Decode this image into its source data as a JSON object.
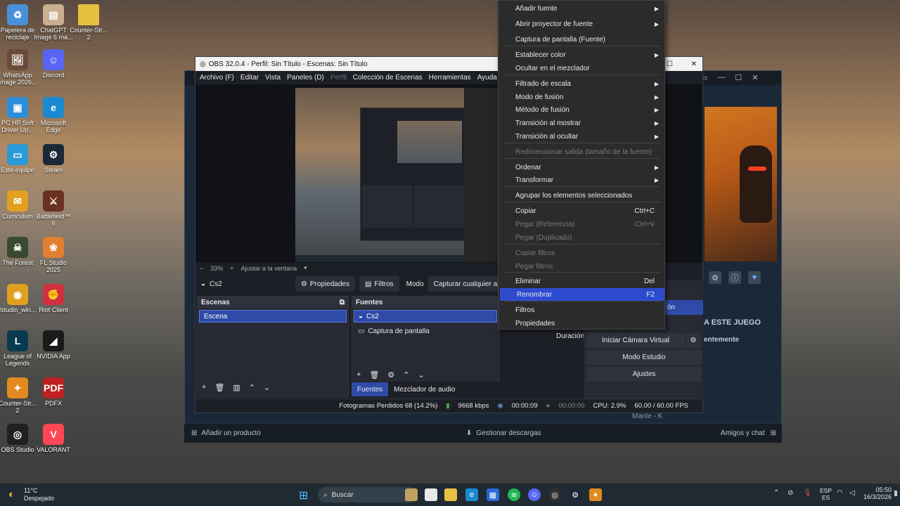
{
  "desktop": {
    "icons": [
      {
        "label": "Papelera de reciclaje",
        "glyph": "♻",
        "color": "#4a90d9"
      },
      {
        "label": "WhatsApp Image 2026...",
        "glyph": "🖼",
        "color": "#6a4a3a"
      },
      {
        "label": "PC HP Soft Driver Up...",
        "glyph": "▣",
        "color": "#2b8ed8"
      },
      {
        "label": "Este equipo",
        "glyph": "▭",
        "color": "#2a9ad8"
      },
      {
        "label": "Curriculum",
        "glyph": "✉",
        "color": "#e0a020"
      },
      {
        "label": "The Forest",
        "glyph": "☠",
        "color": "#3a4a30"
      },
      {
        "label": "fstudio_win...",
        "glyph": "◉",
        "color": "#e0a020"
      },
      {
        "label": "League of Legends",
        "glyph": "L",
        "color": "#0a3a50"
      },
      {
        "label": "Counter-Str... 2",
        "glyph": "✦",
        "color": "#e08a20"
      },
      {
        "label": "OBS Studio",
        "glyph": "◎",
        "color": "#202020"
      }
    ],
    "icons_col2": [
      {
        "label": "ChatGPT Image 6 ma...",
        "glyph": "▤",
        "color": "#c8b090"
      },
      {
        "label": "Discord",
        "glyph": "☺",
        "color": "#5865f2"
      },
      {
        "label": "Microsoft Edge",
        "glyph": "e",
        "color": "#1a8ad0"
      },
      {
        "label": "Steam",
        "glyph": "⚙",
        "color": "#1b2838"
      },
      {
        "label": "Battlefield™ 6",
        "glyph": "⚔",
        "color": "#6a3020"
      },
      {
        "label": "FL Studio 2025",
        "glyph": "❀",
        "color": "#e08030"
      },
      {
        "label": "Riot Client",
        "glyph": "✊",
        "color": "#d03040"
      },
      {
        "label": "NVIDIA App",
        "glyph": "◢",
        "color": "#1a1a1a"
      },
      {
        "label": "PDFX",
        "glyph": "PDF",
        "color": "#c02020"
      },
      {
        "label": "VALORANT",
        "glyph": "V",
        "color": "#ff4655"
      }
    ],
    "folder_label": "Counter-Str... 2"
  },
  "obs": {
    "title": "OBS 32.0.4 - Perfil: Sin Título - Escenas: Sin Título",
    "menu": [
      "Archivo (F)",
      "Editar",
      "Vista",
      "Paneles (D)",
      "Perfil",
      "Colección de Escenas",
      "Herramientas",
      "Ayuda (H)"
    ],
    "zoom": "33%",
    "fit_label": "Ajustar a la ventana",
    "source_name": "Cs2",
    "properties_btn": "Propiedades",
    "filters_btn": "Filtros",
    "mode_label": "Modo",
    "mode_value": "Capturar cualquier aplicaci",
    "scenes_title": "Escenas",
    "scene_items": [
      "Escena"
    ],
    "sources_title": "Fuentes",
    "source_items": [
      "Cs2",
      "Captura de pantalla"
    ],
    "tab_sources": "Fuentes",
    "tab_mixer": "Mezclador de audio",
    "controls": {
      "duration_label": "Duración",
      "virtual_cam": "Iniciar Cámara Virtual",
      "studio_mode": "Modo Estudio",
      "settings": "Ajustes",
      "partial_btn": "ón"
    },
    "status": {
      "dropped": "Fotogramas Perdidos 68 (14.2%)",
      "kbps": "9668 kbps",
      "rec_time": "00:00:09",
      "stream_time": "00:00:00",
      "cpu": "CPU: 2.9%",
      "fps": "60.00 / 60.00 FPS"
    }
  },
  "context_menu": {
    "items": [
      {
        "label": "Añadir fuente",
        "submenu": true,
        "enabled": true
      },
      {
        "label": "Abrir proyector de fuente",
        "submenu": true,
        "enabled": true
      },
      {
        "label": "Captura de pantalla (Fuente)",
        "enabled": true
      },
      {
        "label": "Establecer color",
        "submenu": true,
        "enabled": true
      },
      {
        "label": "Ocultar en el mezclador",
        "enabled": true
      },
      {
        "label": "Filtrado de escala",
        "submenu": true,
        "enabled": true
      },
      {
        "label": "Modo de fusión",
        "submenu": true,
        "enabled": true
      },
      {
        "label": "Método de fusión",
        "submenu": true,
        "enabled": true
      },
      {
        "label": "Transición al mostrar",
        "submenu": true,
        "enabled": true
      },
      {
        "label": "Transición al ocultar",
        "submenu": true,
        "enabled": true
      },
      {
        "label": "Redimensionar salida (tamaño de la fuente)",
        "enabled": false
      },
      {
        "label": "Ordenar",
        "submenu": true,
        "enabled": true
      },
      {
        "label": "Transformar",
        "submenu": true,
        "enabled": true
      },
      {
        "label": "Agrupar los elementos seleccionados",
        "enabled": true
      },
      {
        "label": "Copiar",
        "shortcut": "Ctrl+C",
        "enabled": true
      },
      {
        "label": "Pegar (Referencia)",
        "shortcut": "Ctrl+V",
        "enabled": false
      },
      {
        "label": "Pegar (Duplicado)",
        "enabled": false
      },
      {
        "label": "Copiar filtros",
        "enabled": false
      },
      {
        "label": "Pegar filtros",
        "enabled": false
      },
      {
        "label": "Eliminar",
        "shortcut": "Del",
        "enabled": true
      },
      {
        "label": "Renombrar",
        "shortcut": "F2",
        "enabled": true,
        "highlighted": true
      },
      {
        "label": "Filtros",
        "enabled": true
      },
      {
        "label": "Propiedades",
        "enabled": true
      }
    ]
  },
  "steam": {
    "add_product": "Añadir un producto",
    "downloads": "Gestionar descargas",
    "friends": "Amigos y chat",
    "game_header": "A ESTE JUEGO",
    "recent": "entemente",
    "user": "Mante - K"
  },
  "taskbar": {
    "weather_temp": "11°C",
    "weather_desc": "Despejado",
    "search_placeholder": "Buscar",
    "lang_top": "ESP",
    "lang_bottom": "ES",
    "time": "05:50",
    "date": "16/3/2026"
  }
}
